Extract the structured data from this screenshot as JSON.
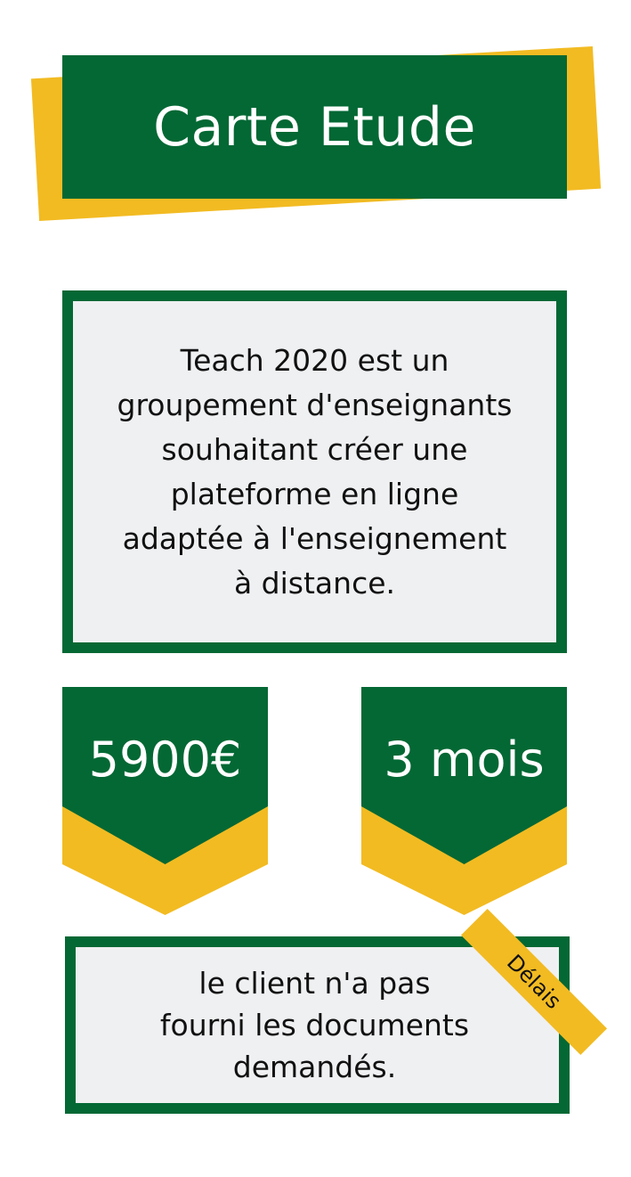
{
  "colors": {
    "green": "#036834",
    "yellow": "#f2bb22",
    "light": "#eff0f2"
  },
  "title": "Carte Etude",
  "description": {
    "lines": [
      "Teach 2020 est un",
      "groupement d'enseignants",
      "souhaitant créer une",
      "plateforme en ligne",
      "adaptée à l'enseignement",
      "à distance."
    ]
  },
  "tags": {
    "price": "5900€",
    "duration": "3 mois"
  },
  "note": {
    "label": "Délais",
    "lines": [
      "le client n'a pas",
      "fourni les documents",
      "demandés."
    ]
  }
}
